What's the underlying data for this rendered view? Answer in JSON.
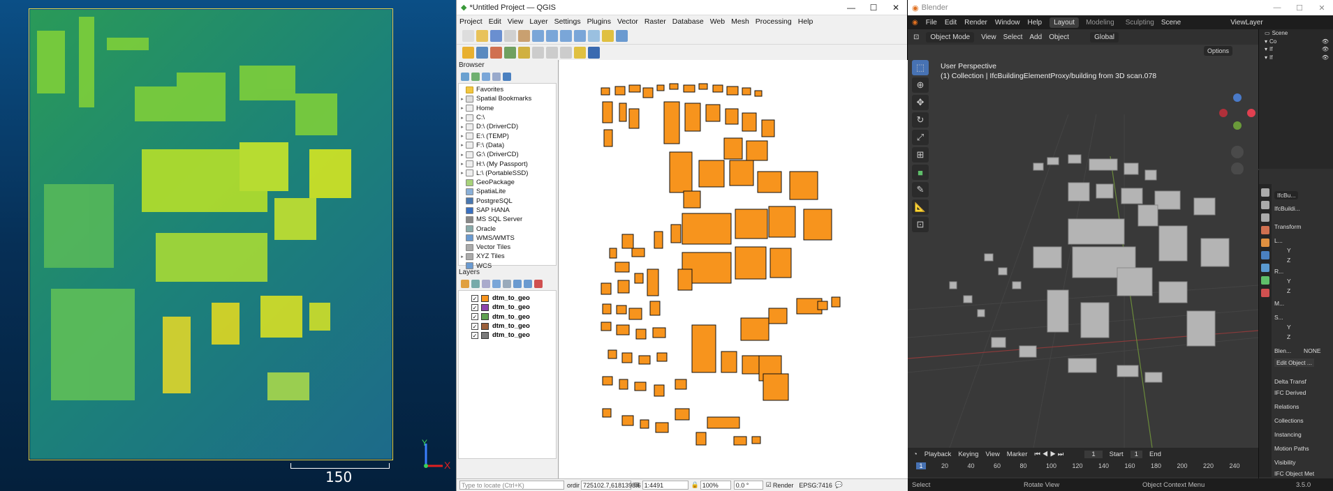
{
  "cloudcompare": {
    "scale_label": "150",
    "axis_y": "Y",
    "axis_x": "X"
  },
  "qgis": {
    "title": "*Untitled Project — QGIS",
    "menu": [
      "Project",
      "Edit",
      "View",
      "Layer",
      "Settings",
      "Plugins",
      "Vector",
      "Raster",
      "Database",
      "Web",
      "Mesh",
      "Processing",
      "Help"
    ],
    "browser_title": "Browser",
    "browser_items": [
      "Favorites",
      "Spatial Bookmarks",
      "Home",
      "C:\\",
      "D:\\ (DriverCD)",
      "E:\\ (TEMP)",
      "F:\\ (Data)",
      "G:\\ (DriverCD)",
      "H:\\ (My Passport)",
      "L:\\ (PortableSSD)",
      "GeoPackage",
      "SpatiaLite",
      "PostgreSQL",
      "SAP HANA",
      "MS SQL Server",
      "Oracle",
      "WMS/WMTS",
      "Vector Tiles",
      "XYZ Tiles",
      "WCS"
    ],
    "layers_title": "Layers",
    "layers": [
      {
        "name": "dtm_to_geo",
        "color": "#f7941d"
      },
      {
        "name": "dtm_to_geo",
        "color": "#8e44ad"
      },
      {
        "name": "dtm_to_geo",
        "color": "#5fa050"
      },
      {
        "name": "dtm_to_geo",
        "color": "#9b5f3a"
      },
      {
        "name": "dtm_to_geo",
        "color": "#7a7a7a"
      }
    ],
    "building_color": "#f7941d",
    "status": {
      "locate_placeholder": "Type to locate (Ctrl+K)",
      "coord_label": "ordir",
      "coord": "725102.7,6181398.6",
      "scale": "1:4491",
      "magnifier": "100%",
      "rotation": "0.0 °",
      "render": "Render",
      "crs": "EPSG:7416"
    }
  },
  "blender": {
    "title": "Blender",
    "menu": [
      "File",
      "Edit",
      "Render",
      "Window",
      "Help"
    ],
    "workspaces": [
      "Layout",
      "Modeling",
      "Sculpting"
    ],
    "scene": "Scene",
    "view_layer": "ViewLayer",
    "mode": "Object Mode",
    "header_menus": [
      "View",
      "Select",
      "Add",
      "Object"
    ],
    "transform": "Global",
    "options": "Options",
    "perspective": "User Perspective",
    "collection_info": "(1) Collection | IfcBuildingElementProxy/building from 3D scan.078",
    "timeline": {
      "menus": [
        "Playback",
        "Keying",
        "View",
        "Marker"
      ],
      "current": "1",
      "start_label": "Start",
      "start": "1",
      "end_label": "End",
      "ticks": [
        "1",
        "20",
        "40",
        "60",
        "80",
        "100",
        "120",
        "140",
        "160",
        "180",
        "200",
        "220",
        "240"
      ]
    },
    "outliner": {
      "root": "Scene",
      "items": [
        "Co",
        "If",
        "If"
      ]
    },
    "props": {
      "object": "IfcBu...",
      "data": "IfcBuildi...",
      "transform": "Transform",
      "loc": "L...",
      "rot": "R...",
      "mode": "M...",
      "scale": "S...",
      "y": "Y",
      "z": "Z",
      "blend": "Blen...",
      "blend_val": "NONE",
      "edit_object": "Edit Object ...",
      "sections": [
        "Delta Transf",
        "IFC Derived",
        "Relations",
        "Collections",
        "Instancing",
        "Motion Paths",
        "Visibility",
        "IFC Object Met"
      ]
    },
    "status": {
      "select": "Select",
      "rotate": "Rotate View",
      "context": "Object Context Menu",
      "version": "3.5.0"
    }
  }
}
